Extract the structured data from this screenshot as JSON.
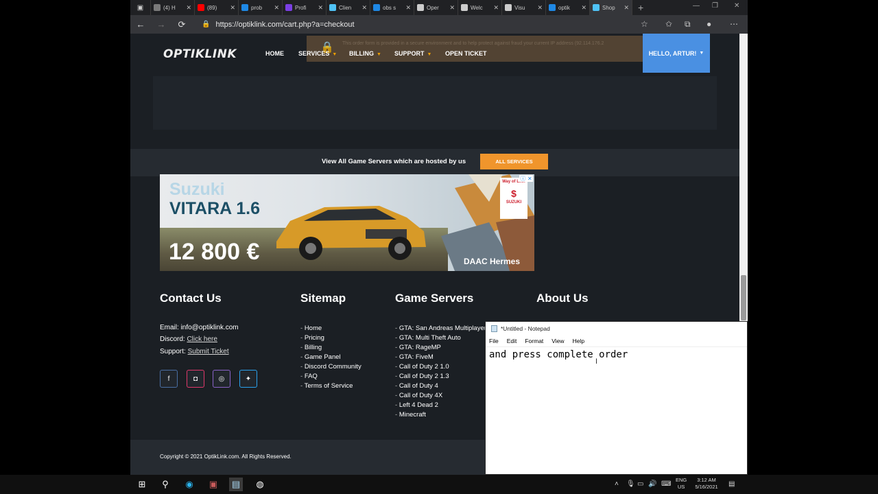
{
  "browser": {
    "tabs": [
      {
        "label": "(4) H",
        "icon": "gray-app-icon",
        "color": "#7a7a7a"
      },
      {
        "label": "(89)",
        "icon": "youtube-icon",
        "color": "#ff0000"
      },
      {
        "label": "prob",
        "icon": "bing-icon",
        "color": "#1e88e5"
      },
      {
        "label": "Profi",
        "icon": "purple-app-icon",
        "color": "#7b3fe4"
      },
      {
        "label": "Clien",
        "icon": "globe-icon",
        "color": "#4fc3f7"
      },
      {
        "label": "obs s",
        "icon": "bing-icon",
        "color": "#1e88e5"
      },
      {
        "label": "Oper",
        "icon": "github-icon",
        "color": "#cccccc"
      },
      {
        "label": "Welc",
        "icon": "document-icon",
        "color": "#cccccc"
      },
      {
        "label": "Visu",
        "icon": "github-icon",
        "color": "#cccccc"
      },
      {
        "label": "optik",
        "icon": "bing-icon",
        "color": "#1e88e5"
      },
      {
        "label": "Shop",
        "icon": "globe-icon",
        "color": "#4fc3f7"
      }
    ],
    "url": "https://optiklink.com/cart.php?a=checkout"
  },
  "site": {
    "logo": "OPTIKLINK",
    "nav": [
      {
        "label": "HOME",
        "caret": false
      },
      {
        "label": "SERVICES",
        "caret": true
      },
      {
        "label": "BILLING",
        "caret": true
      },
      {
        "label": "SUPPORT",
        "caret": true
      },
      {
        "label": "OPEN TICKET",
        "caret": false
      }
    ],
    "secure_notice": "This order form is provided in a secure environment and to help protect against fraud your current IP address (92.114.176.2",
    "user_menu": "HELLO, ARTUR!",
    "services_strip": {
      "text": "View All Game Servers which are hosted by us",
      "button": "ALL SERVICES"
    }
  },
  "ad": {
    "brand": "Suzuki",
    "model": "VITARA 1.6",
    "price": "12 800 €",
    "dealer": "DAAC Hermes",
    "badge_tagline": "Way of Life!",
    "badge_brand": "SUZUKI"
  },
  "footer": {
    "contact": {
      "heading": "Contact Us",
      "email_label": "Email: ",
      "email": "info@optiklink.com",
      "discord_label": "Discord: ",
      "discord_link": "Click here",
      "support_label": "Support: ",
      "support_link": "Submit Ticket"
    },
    "sitemap": {
      "heading": "Sitemap",
      "items": [
        "Home",
        "Pricing",
        "Billing",
        "Game Panel",
        "Discord Community",
        "FAQ",
        "Terms of Service"
      ]
    },
    "game_servers": {
      "heading": "Game Servers",
      "items": [
        "GTA: San Andreas Multiplayer",
        "GTA: Multi Theft Auto",
        "GTA: RageMP",
        "GTA: FiveM",
        "Call of Duty 2 1.0",
        "Call of Duty 2 1.3",
        "Call of Duty 4",
        "Call of Duty 4X",
        "Left 4 Dead 2",
        "Minecraft"
      ]
    },
    "about": {
      "heading": "About Us"
    },
    "copyright": "Copyright © 2021 OptikLink.com. All Rights Reserved."
  },
  "social": [
    {
      "name": "facebook-icon",
      "glyph": "f",
      "border": "#4a6fa5"
    },
    {
      "name": "discord-icon",
      "glyph": "◘",
      "border": "#e0386b"
    },
    {
      "name": "instagram-icon",
      "glyph": "◎",
      "border": "#8a63c9"
    },
    {
      "name": "twitter-icon",
      "glyph": "✦",
      "border": "#2aa3ef"
    }
  ],
  "notepad": {
    "title": "*Untitled - Notepad",
    "menu": [
      "File",
      "Edit",
      "Format",
      "View",
      "Help"
    ],
    "text": "and press complete order"
  },
  "taskbar": {
    "lang_top": "ENG",
    "lang_bottom": "US",
    "time": "3:12 AM",
    "date": "5/16/2021"
  }
}
